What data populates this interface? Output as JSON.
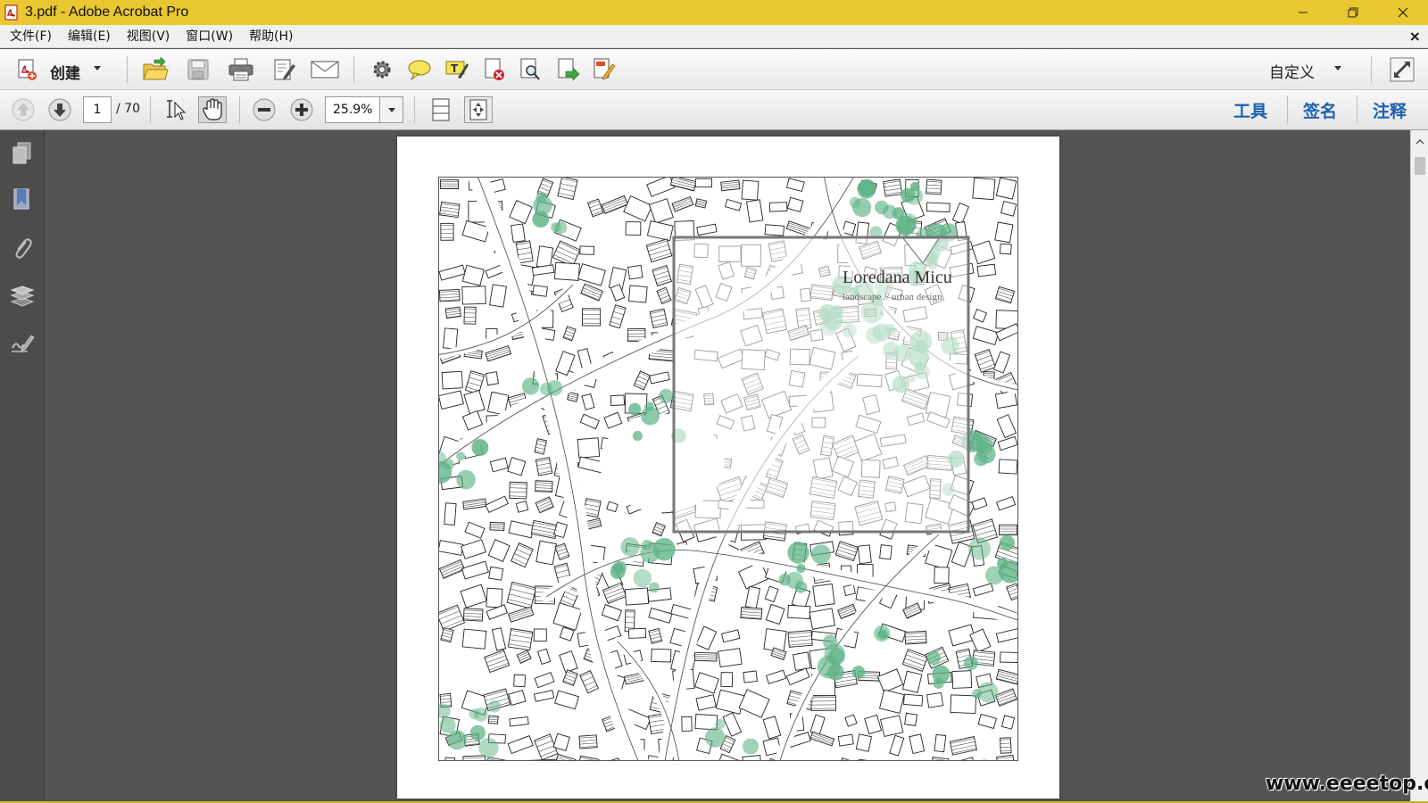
{
  "window": {
    "title": "3.pdf - Adobe Acrobat Pro"
  },
  "menu": [
    {
      "label": "文件(F)"
    },
    {
      "label": "编辑(E)"
    },
    {
      "label": "视图(V)"
    },
    {
      "label": "窗口(W)"
    },
    {
      "label": "帮助(H)"
    }
  ],
  "toolbar": {
    "create_label": "创建",
    "custom_label": "自定义"
  },
  "navigation": {
    "current_page": "1",
    "total_pages": "/ 70",
    "zoom": "25.9%"
  },
  "panes": {
    "tools": "工具",
    "sign": "签名",
    "comment": "注释"
  },
  "document": {
    "title": "Loredana Micu",
    "subtitle": "landscape // urban design"
  },
  "watermark": "www.eeeetop.com",
  "colors": {
    "titlebar": "#e8c731",
    "canvas": "#545454",
    "pane_link": "#1d5fb0",
    "tree_green": "#5fb487"
  }
}
